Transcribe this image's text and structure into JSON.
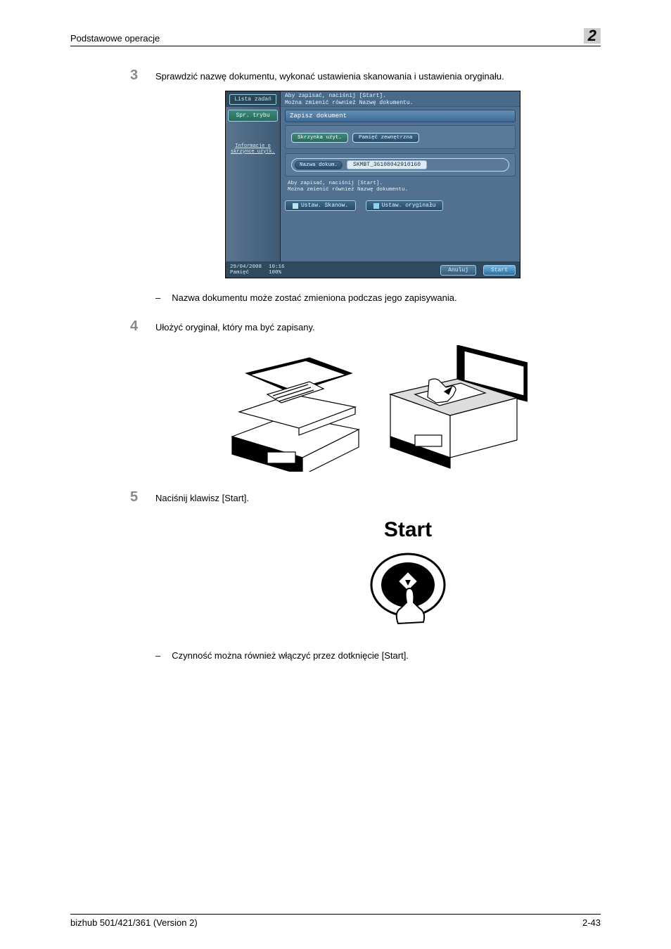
{
  "header": {
    "title": "Podstawowe operacje",
    "chapter": "2"
  },
  "steps": {
    "s3": {
      "num": "3",
      "text": "Sprawdzić nazwę dokumentu, wykonać ustawienia skanowania i ustawienia oryginału.",
      "note_dash": "–",
      "note": "Nazwa dokumentu może zostać zmieniona podczas jego zapisywania."
    },
    "s4": {
      "num": "4",
      "text": "Ułożyć oryginał, który ma być zapisany."
    },
    "s5": {
      "num": "5",
      "text": "Naciśnij klawisz [Start].",
      "note_dash": "–",
      "note": "Czynność można również włączyć przez dotknięcie [Start]."
    }
  },
  "screen": {
    "list_zadan": "Lista zadań",
    "spr_trybu": "Spr. trybu",
    "info_line1": "Informacje o",
    "info_line2": "skrzynce użytk.",
    "hint1": "Aby zapisać, naciśnij [Start].",
    "hint2": "Można zmienić również Nazwę dokumentu.",
    "title": "Zapisz dokument",
    "tab_skrzynka": "Skrzynka użyt.",
    "tab_pamiec": "Pamięć zewnętrzna",
    "name_label": "Nazwa dokum.",
    "name_value": "SKMBT_36108042910160",
    "hint3": "Aby zapisać, naciśnij [Start].",
    "hint4": "Można zmienić również Nazwę dokumentu.",
    "btn_scan": "Ustaw. Skanow.",
    "btn_orig": "Ustaw. oryginału",
    "date": "29/04/2008",
    "time": "10:16",
    "mem_label": "Pamięć",
    "mem_val": "100%",
    "anuluj": "Anuluj",
    "start": "Start"
  },
  "start_figure": {
    "label": "Start"
  },
  "footer": {
    "left": "bizhub 501/421/361 (Version 2)",
    "right": "2-43"
  }
}
